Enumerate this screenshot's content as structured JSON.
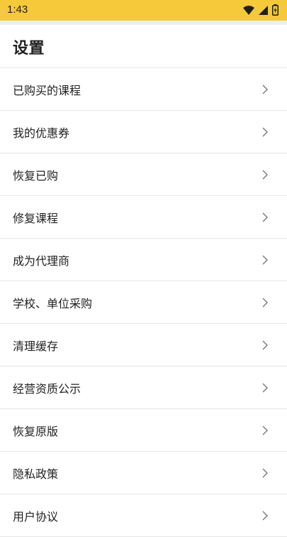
{
  "status_bar": {
    "time": "1:43",
    "icons": [
      "wifi-icon",
      "signal-icon",
      "battery-icon"
    ],
    "background_color": "#f5c93a"
  },
  "page": {
    "title": "设置"
  },
  "menu": {
    "items": [
      {
        "label": "已购买的课程"
      },
      {
        "label": "我的优惠券"
      },
      {
        "label": "恢复已购"
      },
      {
        "label": "修复课程"
      },
      {
        "label": "成为代理商"
      },
      {
        "label": "学校、单位采购"
      },
      {
        "label": "清理缓存"
      },
      {
        "label": "经营资质公示"
      },
      {
        "label": "恢复原版"
      },
      {
        "label": "隐私政策"
      },
      {
        "label": "用户协议"
      }
    ]
  }
}
